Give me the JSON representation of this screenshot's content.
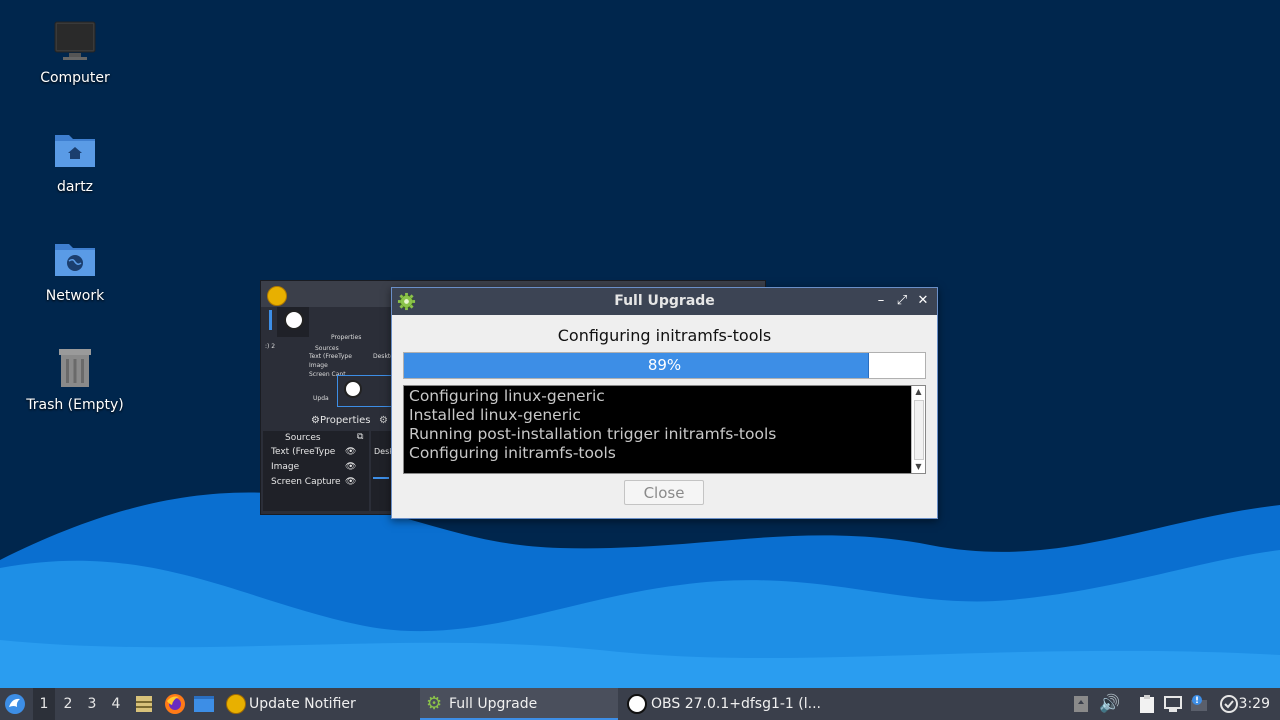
{
  "desktop": {
    "icons": [
      {
        "label": "Computer"
      },
      {
        "label": "dartz"
      },
      {
        "label": "Network"
      },
      {
        "label": "Trash (Empty)"
      }
    ]
  },
  "obs_preview": {
    "properties_label": "Properties",
    "sources_label": "Sources",
    "sources": [
      "Text (FreeType",
      "Image",
      "Screen Capture"
    ],
    "small_properties": "Properties",
    "small_sources": "Sources",
    "small_source_items": [
      "Text (FreeType",
      "Image",
      "Screen Capt"
    ],
    "small_update": "Upda",
    "desk_label": "Desk",
    "small_desk": "Desktop"
  },
  "dialog": {
    "title": "Full Upgrade",
    "status": "Configuring initramfs-tools",
    "progress_percent": 89,
    "progress_label": "89%",
    "log_lines": [
      "Configuring linux-generic",
      "Installed linux-generic",
      "Running post-installation trigger initramfs-tools",
      "Configuring initramfs-tools"
    ],
    "close_label": "Close",
    "minimize_glyph": "–",
    "restore_glyph": "⤢",
    "close_glyph": "✕"
  },
  "taskbar": {
    "workspaces": [
      "1",
      "2",
      "3",
      "4"
    ],
    "active_workspace": "1",
    "tasks": [
      {
        "label": "Update Notifier",
        "icon": "update-notifier-icon"
      },
      {
        "label": "Full Upgrade",
        "icon": "gear-icon"
      },
      {
        "label": "OBS 27.0.1+dfsg1-1 (l...",
        "icon": "obs-icon"
      }
    ],
    "clock": "3:29"
  },
  "colors": {
    "desktop_bg": "#00264d",
    "wave_light": "#1e8fe6",
    "accent": "#3d8ee6",
    "titlebar": "#3c4454",
    "taskbar": "#3a3f4b"
  }
}
